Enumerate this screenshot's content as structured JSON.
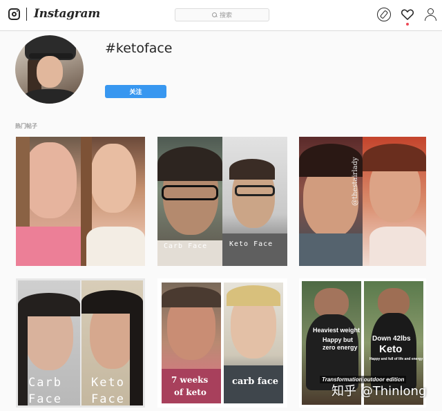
{
  "topbar": {
    "brand": "Instagram",
    "search_placeholder": "搜索"
  },
  "header": {
    "hashtag": "#ketoface",
    "follow_label": "关注"
  },
  "section": {
    "title": "热门帖子"
  },
  "posts": [
    {
      "overlays": []
    },
    {
      "overlays": [
        "Carb Face",
        "Keto Face"
      ]
    },
    {
      "overlays": [
        "@thestairlady"
      ]
    },
    {
      "overlays": [
        "Carb",
        "Face",
        "Keto",
        "Face"
      ]
    },
    {
      "overlays": [
        "7 weeks",
        "of keto",
        "carb face"
      ]
    },
    {
      "overlays": [
        "Heaviest weight",
        "Happy but",
        "zero energy",
        "Down 42lbs",
        "Keto",
        "Happy and full of life and energy",
        "Transformation outdoor edition"
      ]
    }
  ],
  "watermark": "知乎 @Thinlong",
  "colors": {
    "accent": "#3897f0",
    "notification": "#ed4956",
    "border": "#dbdbdb"
  },
  "icons": [
    "instagram-logo-icon",
    "search-icon",
    "compass-icon",
    "heart-icon",
    "user-icon"
  ]
}
